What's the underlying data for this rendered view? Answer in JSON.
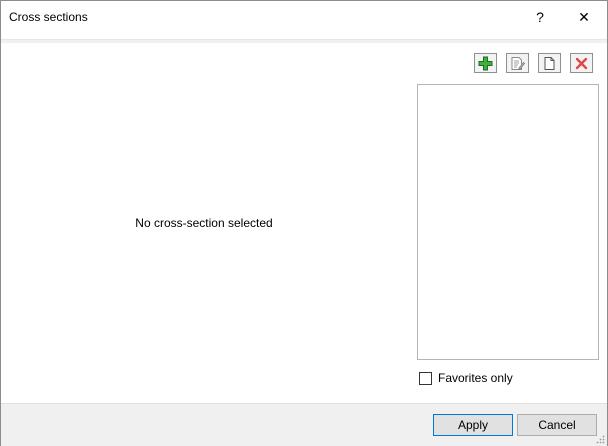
{
  "window": {
    "title": "Cross sections",
    "help_label": "?",
    "close_label": "✕"
  },
  "main": {
    "empty_message": "No cross-section selected"
  },
  "toolbar": {
    "add_icon": "add-icon",
    "edit_icon": "edit-icon",
    "copy_icon": "copy-icon",
    "delete_icon": "delete-icon"
  },
  "filter": {
    "favorites_label": "Favorites only",
    "favorites_checked": false
  },
  "footer": {
    "apply_label": "Apply",
    "cancel_label": "Cancel"
  },
  "colors": {
    "add_green": "#2e9a2e",
    "delete_red": "#e04848",
    "apply_border": "#0078d7"
  }
}
